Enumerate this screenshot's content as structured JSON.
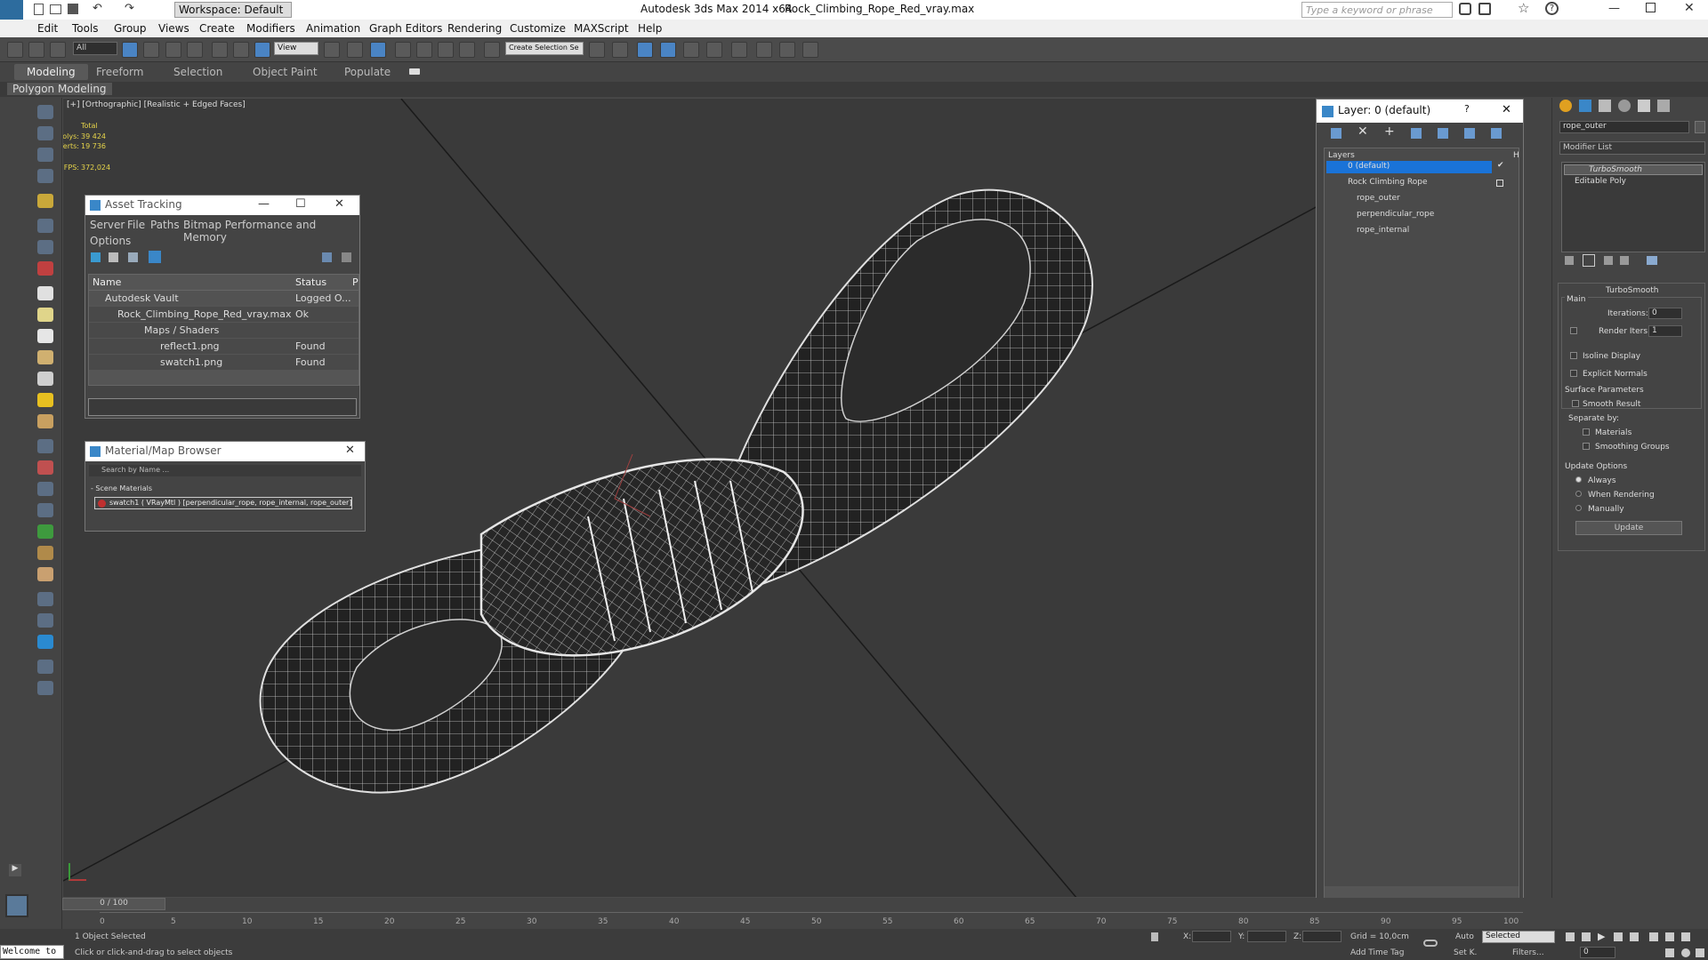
{
  "titlebar": {
    "workspace": "Workspace: Default",
    "app": "Autodesk 3ds Max  2014 x64",
    "file": "Rock_Climbing_Rope_Red_vray.max",
    "search_placeholder": "Type a keyword or phrase"
  },
  "menu": [
    "Edit",
    "Tools",
    "Group",
    "Views",
    "Create",
    "Modifiers",
    "Animation",
    "Graph Editors",
    "Rendering",
    "Customize",
    "MAXScript",
    "Help"
  ],
  "toolbar": {
    "selection_filter": "All",
    "ref_coord": "View",
    "named_selection": "Create Selection Se"
  },
  "ribbon": {
    "tabs": [
      "Modeling",
      "Freeform",
      "Selection",
      "Object Paint",
      "Populate"
    ],
    "subtab": "Polygon Modeling"
  },
  "viewport": {
    "label": "[+] [Orthographic] [Realistic + Edged Faces]",
    "stats": {
      "total_label": "Total",
      "polys_label": "Polys:",
      "polys": "39 424",
      "verts_label": "Verts:",
      "verts": "19 736",
      "fps_label": "FPS:",
      "fps": "372,024"
    }
  },
  "asset_tracking": {
    "title": "Asset Tracking",
    "menu": [
      "Server",
      "File",
      "Paths",
      "Bitmap Performance and Memory",
      "Options"
    ],
    "columns": [
      "Name",
      "Status",
      "P"
    ],
    "rows": [
      {
        "name": "Autodesk Vault",
        "status": "Logged O..."
      },
      {
        "name": "Rock_Climbing_Rope_Red_vray.max",
        "status": "Ok"
      },
      {
        "name": "Maps / Shaders",
        "status": ""
      },
      {
        "name": "reflect1.png",
        "status": "Found"
      },
      {
        "name": "swatch1.png",
        "status": "Found"
      }
    ]
  },
  "material_browser": {
    "title": "Material/Map Browser",
    "search": "Search by Name ...",
    "section": "- Scene Materials",
    "item": "swatch1  ( VRayMtl )  [perpendicular_rope, rope_internal, rope_outer]"
  },
  "layer_dialog": {
    "title": "Layer: 0 (default)",
    "help": "?",
    "header": "Layers",
    "header_right": "H",
    "items": [
      "0 (default)",
      "Rock Climbing Rope",
      "rope_outer",
      "perpendicular_rope",
      "rope_internal"
    ]
  },
  "command_panel": {
    "object_name": "rope_outer",
    "modifier_list": "Modifier List",
    "stack": [
      "TurboSmooth",
      "Editable Poly"
    ],
    "rollout_title": "TurboSmooth",
    "main": "Main",
    "iterations_label": "Iterations:",
    "iterations": "0",
    "render_iters_label": "Render Iters:",
    "render_iters": "1",
    "isoline": "Isoline Display",
    "explicit_normals": "Explicit Normals",
    "surface_params": "Surface Parameters",
    "smooth_result": "Smooth Result",
    "separate_by": "Separate by:",
    "materials": "Materials",
    "smoothing_groups": "Smoothing Groups",
    "update_options": "Update Options",
    "always": "Always",
    "when_rendering": "When Rendering",
    "manually": "Manually",
    "update_button": "Update"
  },
  "timeline": {
    "frame": "0 / 100",
    "ticks": [
      "0",
      "5",
      "10",
      "15",
      "20",
      "25",
      "30",
      "35",
      "40",
      "45",
      "50",
      "55",
      "60",
      "65",
      "70",
      "75",
      "80",
      "85",
      "90",
      "95",
      "100"
    ]
  },
  "status": {
    "selected": "1 Object Selected",
    "prompt": "Click or click-and-drag to select objects",
    "welcome": "Welcome to",
    "x_label": "X:",
    "y_label": "Y:",
    "z_label": "Z:",
    "grid": "Grid = 10,0cm",
    "add_time_tag": "Add Time Tag",
    "auto": "Auto",
    "set_k": "Set K.",
    "key_filter": "Selected",
    "filters": "Filters...",
    "frame_field": "0"
  }
}
